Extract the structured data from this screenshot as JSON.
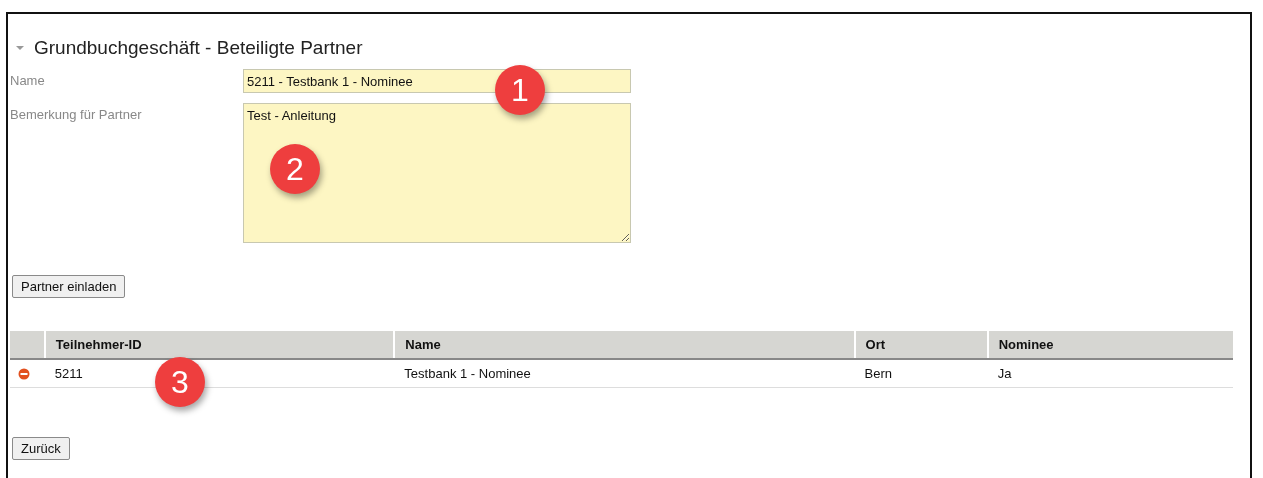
{
  "section": {
    "title": "Grundbuchgeschäft - Beteiligte Partner",
    "expanded": true
  },
  "form": [
    {
      "label": "Name",
      "kind": "input",
      "value": "5211 - Testbank 1 - Nominee"
    },
    {
      "label": "Bemerkung für Partner",
      "kind": "textarea",
      "value": "Test - Anleitung"
    }
  ],
  "invite_button": "Partner einladen",
  "table": {
    "columns": [
      "Teilnehmer-ID",
      "Name",
      "Ort",
      "Nominee"
    ],
    "rows": [
      {
        "cells": [
          "5211",
          "Testbank 1 - Nominee",
          "Bern",
          "Ja"
        ]
      }
    ]
  },
  "back_button": "Zurück",
  "callouts": [
    {
      "number": "1"
    },
    {
      "number": "2"
    },
    {
      "number": "3"
    }
  ]
}
